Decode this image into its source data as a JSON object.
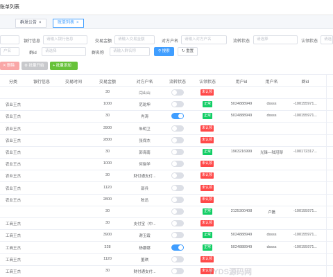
{
  "breadcrumb": "账单列表",
  "tabs": [
    {
      "label": "群发公告",
      "close": "×",
      "active": false
    },
    {
      "label": "账单列表",
      "close": "×",
      "active": true
    }
  ],
  "filters": {
    "bank_info_label": "银行信息",
    "bank_info_placeholder": "请输入银行信息",
    "amount_label": "交易金额",
    "amount_placeholder": "请输入交易金额",
    "counterparty_label": "对方户名",
    "counterparty_placeholder": "请输入对方户名",
    "flow_label": "流转状态",
    "flow_placeholder": "请选择",
    "auth_label": "认领状态",
    "auth_placeholder": "请选",
    "row2_first_placeholder": "户名",
    "group_id_label": "群id",
    "group_id_placeholder": "请选择",
    "group_name_label": "群名称",
    "group_name_placeholder": "请输入群名称",
    "search_label": "搜索",
    "reset_label": "重置"
  },
  "actions": {
    "delete_label": "删除",
    "batch_label": "批量开始",
    "add_label": "+ 批量添加"
  },
  "columns": [
    "分类",
    "银行信息",
    "交易时间",
    "交易金额",
    "对方户名",
    "流转状态",
    "认领状态",
    "用户id",
    "用户名",
    "群id"
  ],
  "rows": [
    {
      "cat": "",
      "bank": "",
      "time": "",
      "amount": "30",
      "party": "闫山山",
      "toggle": false,
      "status": "未认领",
      "ok": false,
      "uid": "",
      "uname": "",
      "gid": ""
    },
    {
      "cat": "农业王杰",
      "bank": "",
      "time": "",
      "amount": "1000",
      "party": "范乾坤",
      "toggle": false,
      "status": "正常",
      "ok": true,
      "uid": "5024888949",
      "uname": "dssss",
      "gid": "-100155971..."
    },
    {
      "cat": "农业王杰",
      "bank": "",
      "time": "",
      "amount": "30",
      "party": "肖涛",
      "toggle": true,
      "status": "正常",
      "ok": true,
      "uid": "5024888949",
      "uname": "dssss",
      "gid": "-100155971..."
    },
    {
      "cat": "农业王杰",
      "bank": "",
      "time": "",
      "amount": "3900",
      "party": "朱明卫",
      "toggle": false,
      "status": "未认领",
      "ok": false,
      "uid": "",
      "uname": "",
      "gid": ""
    },
    {
      "cat": "农业王杰",
      "bank": "",
      "time": "",
      "amount": "2800",
      "party": "张保杰",
      "toggle": false,
      "status": "未认领",
      "ok": false,
      "uid": "",
      "uname": "",
      "gid": ""
    },
    {
      "cat": "农业王杰",
      "bank": "",
      "time": "",
      "amount": "30",
      "party": "郭海南",
      "toggle": false,
      "status": "正常",
      "ok": true,
      "uid": "1963216999",
      "uname": "光锋—陆冠琴",
      "gid": "-100172317..."
    },
    {
      "cat": "农业王杰",
      "bank": "",
      "time": "",
      "amount": "1000",
      "party": "何晓学",
      "toggle": false,
      "status": "未认领",
      "ok": false,
      "uid": "",
      "uname": "",
      "gid": ""
    },
    {
      "cat": "农业王杰",
      "bank": "",
      "time": "",
      "amount": "30",
      "party": "财付通支付...",
      "toggle": false,
      "status": "未认领",
      "ok": false,
      "uid": "",
      "uname": "",
      "gid": ""
    },
    {
      "cat": "农业王杰",
      "bank": "",
      "time": "",
      "amount": "1120",
      "party": "邵兵",
      "toggle": false,
      "status": "未认领",
      "ok": false,
      "uid": "",
      "uname": "",
      "gid": ""
    },
    {
      "cat": "农业王杰",
      "bank": "",
      "time": "",
      "amount": "2800",
      "party": "陈迅",
      "toggle": false,
      "status": "未认领",
      "ok": false,
      "uid": "",
      "uname": "",
      "gid": ""
    },
    {
      "cat": "",
      "bank": "",
      "time": "",
      "amount": "30",
      "party": "",
      "toggle": false,
      "status": "正常",
      "ok": true,
      "uid": "2125300408",
      "uname": "卢磊",
      "gid": "-100155971..."
    },
    {
      "cat": "工商王杰",
      "bank": "",
      "time": "",
      "amount": "30",
      "party": "支付宝（中...",
      "toggle": false,
      "status": "未认领",
      "ok": false,
      "uid": "",
      "uname": "",
      "gid": ""
    },
    {
      "cat": "工商王杰",
      "bank": "",
      "time": "",
      "amount": "3900",
      "party": "谢玉霞",
      "toggle": false,
      "status": "正常",
      "ok": true,
      "uid": "5024888949",
      "uname": "dssss",
      "gid": "-100155971..."
    },
    {
      "cat": "工商王杰",
      "bank": "",
      "time": "",
      "amount": "328",
      "party": "杨娜娜",
      "toggle": true,
      "status": "正常",
      "ok": true,
      "uid": "5024888949",
      "uname": "dssss",
      "gid": "-100155971..."
    },
    {
      "cat": "工商王杰",
      "bank": "",
      "time": "",
      "amount": "1120",
      "party": "董琪",
      "toggle": false,
      "status": "未认领",
      "ok": false,
      "uid": "",
      "uname": "",
      "gid": ""
    },
    {
      "cat": "工商王杰",
      "bank": "",
      "time": "",
      "amount": "30",
      "party": "财付通支付...",
      "toggle": false,
      "status": "未认领",
      "ok": false,
      "uid": "",
      "uname": "",
      "gid": ""
    }
  ],
  "watermark": "YYDS源码网",
  "colors": {
    "primary": "#409eff",
    "success": "#13ce66",
    "danger": "#ff4949",
    "delete_btn": "#f78989",
    "batch_btn": "#a6a9ad",
    "add_btn": "#67c23a"
  }
}
